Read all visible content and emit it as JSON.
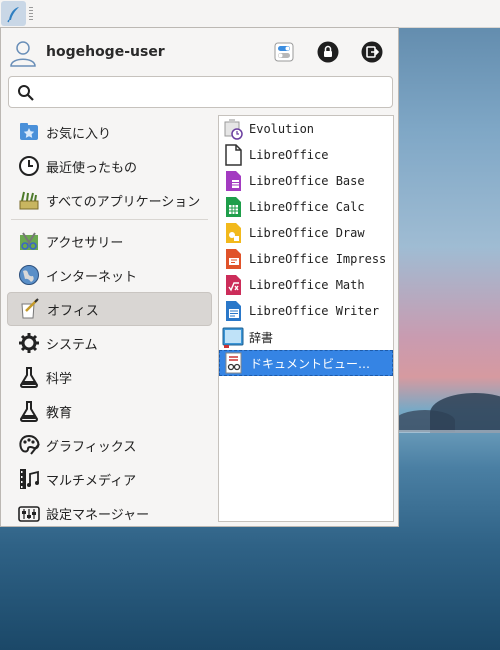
{
  "user": {
    "name": "hogehoge-user"
  },
  "header_buttons": [
    "settings-toggle-icon",
    "lock-icon",
    "logout-icon"
  ],
  "search": {
    "value": "",
    "placeholder": ""
  },
  "favorites": [
    {
      "label": "お気に入り",
      "icon": "star-folder-icon"
    },
    {
      "label": "最近使ったもの",
      "icon": "clock-icon"
    },
    {
      "label": "すべてのアプリケーション",
      "icon": "all-apps-icon"
    }
  ],
  "categories": [
    {
      "label": "アクセサリー",
      "icon": "accessories-icon"
    },
    {
      "label": "インターネット",
      "icon": "globe-icon"
    },
    {
      "label": "オフィス",
      "icon": "office-icon",
      "selected": true
    },
    {
      "label": "システム",
      "icon": "gear-icon"
    },
    {
      "label": "科学",
      "icon": "flask-icon"
    },
    {
      "label": "教育",
      "icon": "flask-icon"
    },
    {
      "label": "グラフィックス",
      "icon": "palette-icon"
    },
    {
      "label": "マルチメディア",
      "icon": "film-music-icon"
    },
    {
      "label": "設定マネージャー",
      "icon": "settings-manager-icon"
    }
  ],
  "apps": [
    {
      "label": "Evolution",
      "icon": "evolution-icon"
    },
    {
      "label": "LibreOffice",
      "icon": "libreoffice-icon"
    },
    {
      "label": "LibreOffice Base",
      "icon": "libreoffice-base-icon"
    },
    {
      "label": "LibreOffice Calc",
      "icon": "libreoffice-calc-icon"
    },
    {
      "label": "LibreOffice Draw",
      "icon": "libreoffice-draw-icon"
    },
    {
      "label": "LibreOffice Impress",
      "icon": "libreoffice-impress-icon"
    },
    {
      "label": "LibreOffice Math",
      "icon": "libreoffice-math-icon"
    },
    {
      "label": "LibreOffice Writer",
      "icon": "libreoffice-writer-icon"
    },
    {
      "label": "辞書",
      "icon": "dictionary-icon"
    },
    {
      "label": "ドキュメントビュー…",
      "icon": "document-viewer-icon",
      "selected": true
    }
  ],
  "colors": {
    "accent": "#3584e4",
    "panel": "#f5f4f3",
    "menu_bg": "#f6f5f4"
  }
}
